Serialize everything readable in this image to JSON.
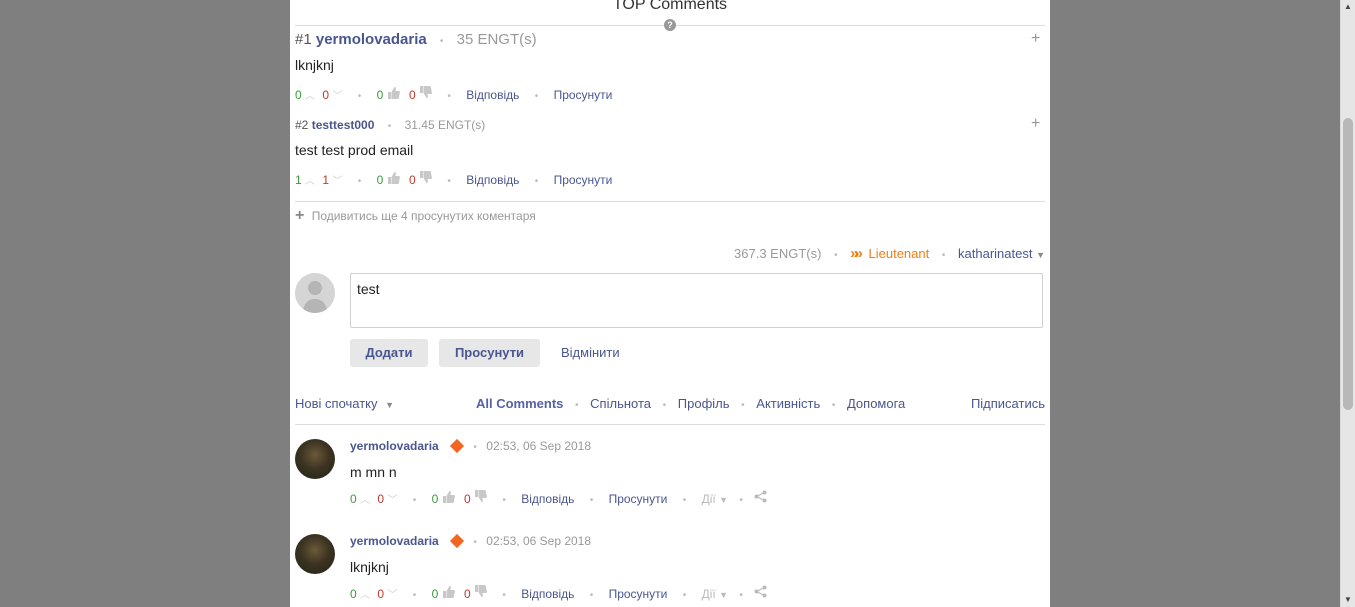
{
  "header": {
    "title": "TOP Comments",
    "help": "?"
  },
  "top_comments": [
    {
      "rank": "#1",
      "author": "yermolovadaria",
      "reward": "35 ENGT(s)",
      "expand": "+",
      "text": "lknjknj",
      "up": "0",
      "down": "0",
      "likes": "0",
      "dislikes": "0",
      "reply": "Відповідь",
      "promote": "Просунути"
    },
    {
      "rank": "#2",
      "author": "testtest000",
      "reward": "31.45 ENGT(s)",
      "expand": "+",
      "text": "test test prod email",
      "up": "1",
      "down": "1",
      "likes": "0",
      "dislikes": "0",
      "reply": "Відповідь",
      "promote": "Просунути"
    }
  ],
  "more_promoted": {
    "icon": "+",
    "label": "Подивитись ще 4 просунутих коментаря"
  },
  "user_bar": {
    "balance": "367.3 ENGT(s)",
    "rank": "Lieutenant",
    "username": "katharinatest"
  },
  "composer": {
    "value": "test",
    "add_label": "Додати",
    "promote_label": "Просунути",
    "cancel_label": "Відмінити"
  },
  "filters": {
    "sort": "Нові спочатку",
    "tabs": [
      "All Comments",
      "Спільнота",
      "Профіль",
      "Активність",
      "Допомога"
    ],
    "subscribe": "Підписатись"
  },
  "comments": [
    {
      "author": "yermolovadaria",
      "time": "02:53, 06 Sep 2018",
      "text": "m mn n",
      "up": "0",
      "down": "0",
      "likes": "0",
      "dislikes": "0",
      "reply": "Відповідь",
      "promote": "Просунути",
      "actions": "Дії"
    },
    {
      "author": "yermolovadaria",
      "time": "02:53, 06 Sep 2018",
      "text": "lknjknj",
      "up": "0",
      "down": "0",
      "likes": "0",
      "dislikes": "0",
      "reply": "Відповідь",
      "promote": "Просунути",
      "actions": "Дії"
    }
  ],
  "colors": {
    "accent": "#4a5690",
    "positive": "#3c9a3c",
    "negative": "#c0392b",
    "rank": "#f07d16",
    "badge": "#f26522"
  }
}
